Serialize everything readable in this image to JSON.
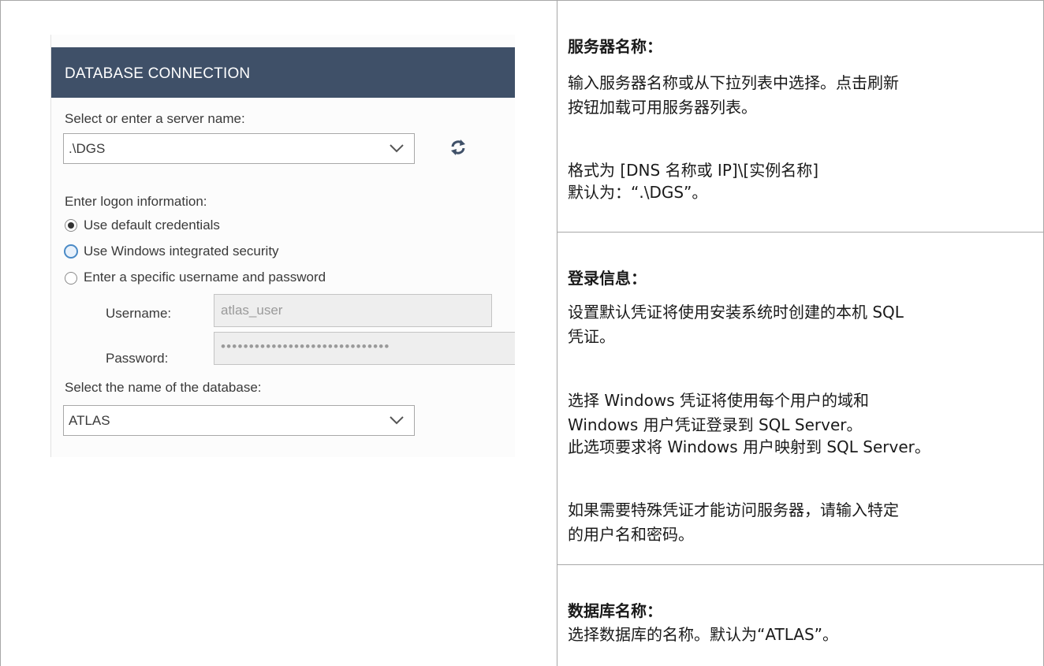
{
  "dialog": {
    "header": "DATABASE CONNECTION",
    "server_label": "Select or enter a server name:",
    "server_value": ".\\DGS",
    "logon_label": "Enter logon information:",
    "radio_options": [
      "Use default credentials",
      "Use Windows integrated security",
      "Enter a specific username and password"
    ],
    "selected_option": "Use default credentials",
    "username_label": "Username:",
    "username_value": "atlas_user",
    "password_label": "Password:",
    "password_value": "••••••••••••••••••••••••••••••",
    "database_label": "Select the name of the database:",
    "database_value": "ATLAS",
    "icons": [
      "chevron-down-icon",
      "refresh-icon"
    ],
    "colors": {
      "header_bg": "#3f5068",
      "radio_focus": "#4a8ac6"
    }
  },
  "help": {
    "server": {
      "title": "服务器名称：",
      "line1": "输入服务器名称或从下拉列表中选择。点击刷新",
      "line2": "按钮加载可用服务器列表。",
      "line3": "格式为 [DNS 名称或 IP]\\[实例名称]",
      "line4": "默认为：“.\\DGS”。"
    },
    "logon": {
      "title": "登录信息：",
      "line1": "设置默认凭证将使用安装系统时创建的本机 SQL",
      "line2": "凭证。",
      "line3": "选择 Windows 凭证将使用每个用户的域和",
      "line4": "Windows 用户凭证登录到 SQL Server。",
      "line5": "此选项要求将 Windows 用户映射到 SQL Server。",
      "line6": "如果需要特殊凭证才能访问服务器，请输入特定",
      "line7": "的用户名和密码。"
    },
    "database": {
      "title": "数据库名称：",
      "line1": "选择数据库的名称。默认为“ATLAS”。"
    }
  }
}
